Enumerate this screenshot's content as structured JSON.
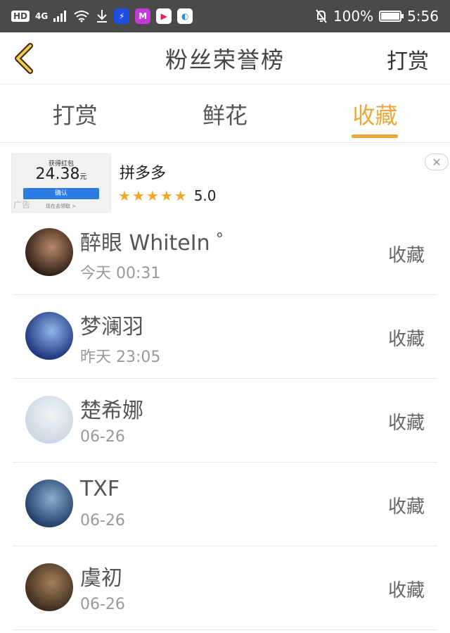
{
  "statusbar": {
    "hd": "HD",
    "network": "4G",
    "battery_text": "100%",
    "battery_level": 1.0,
    "time": "5:56"
  },
  "header": {
    "title": "粉丝荣誉榜",
    "action": "打赏"
  },
  "tabs": [
    {
      "label": "打赏",
      "active": false
    },
    {
      "label": "鲜花",
      "active": false
    },
    {
      "label": "收藏",
      "active": true
    }
  ],
  "ad": {
    "thumb_title": "获得红包",
    "thumb_amount": "24.38",
    "thumb_unit": "元",
    "thumb_button": "确认",
    "thumb_tag": "广告",
    "thumb_small": "现在去领取 >",
    "name": "拼多多",
    "rating": "5.0",
    "stars": 5
  },
  "list": [
    {
      "name": "醉眼 WhiteIn ゜",
      "time": "今天 00:31",
      "action": "收藏",
      "avatar_colors": [
        "#2a1a12",
        "#b88a6a"
      ]
    },
    {
      "name": "梦澜羽",
      "time": "昨天 23:05",
      "action": "收藏",
      "avatar_colors": [
        "#1b2f7a",
        "#8fb8e8"
      ]
    },
    {
      "name": "楚希娜",
      "time": "06-26",
      "action": "收藏",
      "avatar_colors": [
        "#c9d6e4",
        "#f2f4f7"
      ]
    },
    {
      "name": "TXF",
      "time": "06-26",
      "action": "收藏",
      "avatar_colors": [
        "#1e3a66",
        "#8aaed0"
      ]
    },
    {
      "name": "虞初",
      "time": "06-26",
      "action": "收藏",
      "avatar_colors": [
        "#3a2a1c",
        "#a68058"
      ]
    }
  ],
  "colors": {
    "accent": "#e8a93a",
    "statusbar": "#4a4a4a",
    "star": "#f5a623"
  }
}
